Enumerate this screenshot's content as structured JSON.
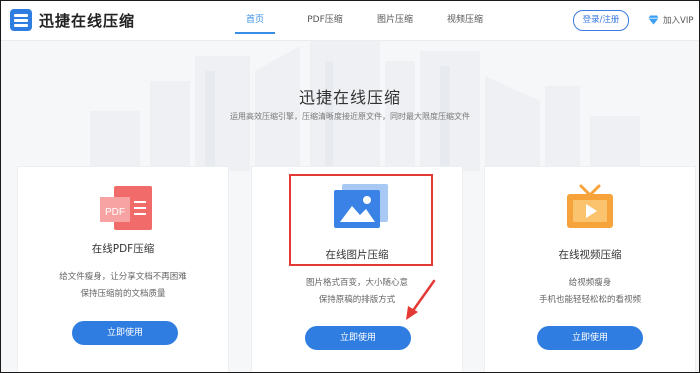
{
  "header": {
    "logo_text": "迅捷在线压缩",
    "nav": [
      {
        "label": "首页",
        "active": true
      },
      {
        "label": "PDF压缩",
        "active": false
      },
      {
        "label": "图片压缩",
        "active": false
      },
      {
        "label": "视频压缩",
        "active": false
      }
    ],
    "login_label": "登录/注册",
    "vip_label": "加入VIP"
  },
  "hero": {
    "title": "迅捷在线压缩",
    "subtitle": "运用高效压缩引擎，压缩清晰度接近原文件，同时最大限度压缩文件"
  },
  "cards": [
    {
      "icon": "pdf-icon",
      "icon_text": "PDF",
      "title": "在线PDF压缩",
      "desc_line1": "给文件瘦身，让分享文档不再困难",
      "desc_line2": "保持压缩前的文档质量",
      "button": "立即使用"
    },
    {
      "icon": "image-icon",
      "title": "在线图片压缩",
      "desc_line1": "图片格式百变，大小随心意",
      "desc_line2": "保持原稿的排版方式",
      "button": "立即使用"
    },
    {
      "icon": "video-tv-icon",
      "title": "在线视频压缩",
      "desc_line1": "给视频瘦身",
      "desc_line2": "手机也能轻轻松松的看视频",
      "button": "立即使用"
    }
  ],
  "colors": {
    "primary": "#2f7de1",
    "pdf": "#f26b6b",
    "image": "#3a82e6",
    "video": "#f7a33b",
    "annotation": "#e53935"
  }
}
